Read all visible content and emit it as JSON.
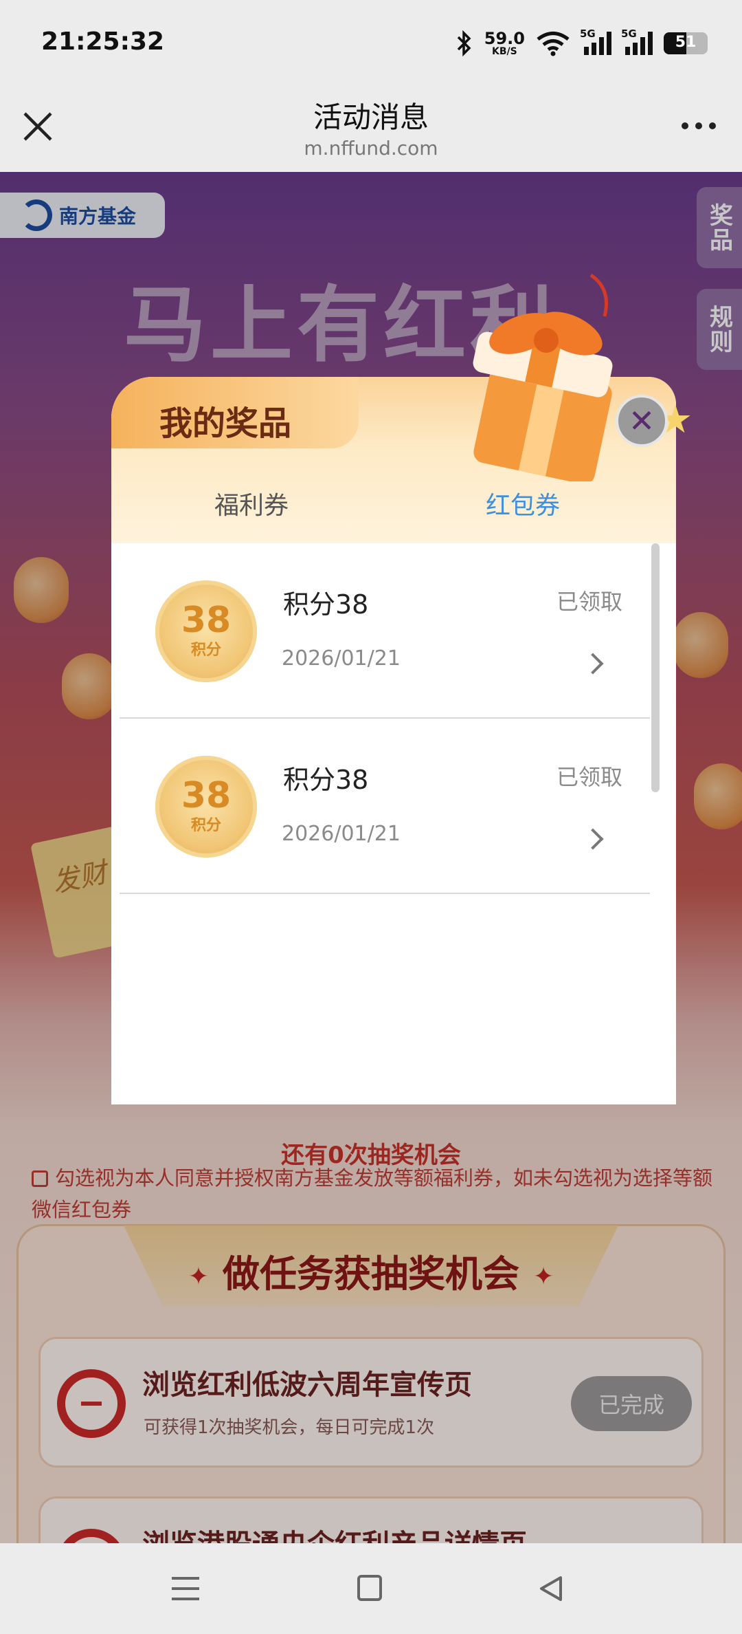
{
  "status_bar": {
    "time": "21:25:32",
    "net_speed_value": "59.0",
    "net_speed_unit": "KB/S",
    "signal1_label": "5G",
    "signal2_label": "5G",
    "battery": "51"
  },
  "titlebar": {
    "title": "活动消息",
    "url": "m.nffund.com"
  },
  "page": {
    "logo_text": "南方基金",
    "headline": "马上有红利",
    "side_tab_prizes": "奖品",
    "side_tab_rules": "规则",
    "ticket_text": "发财",
    "chance_text": "还有0次抽奖机会",
    "consent_text": "勾选视为本人同意并授权南方基金发放等额福利券，如未勾选视为选择等额微信红包券",
    "task_section_title": "做任务获抽奖机会",
    "tasks": [
      {
        "name": "浏览红利低波六周年宣传页",
        "desc": "可获得1次抽奖机会，每日可完成1次",
        "button": "已完成"
      },
      {
        "name": "浏览港股通央企红利产品详情页",
        "desc": "",
        "button": ""
      }
    ]
  },
  "modal": {
    "title": "我的奖品",
    "tabs": [
      "福利券",
      "红包券"
    ],
    "active_tab": "红包券",
    "items": [
      {
        "coin_value": "38",
        "coin_unit": "积分",
        "name": "积分38",
        "date": "2026/01/21",
        "status": "已领取"
      },
      {
        "coin_value": "38",
        "coin_unit": "积分",
        "name": "积分38",
        "date": "2026/01/21",
        "status": "已领取"
      }
    ]
  },
  "colors": {
    "active_tab": "#3d8fe0",
    "accent_red": "#c7332a",
    "modal_header": "#fbd39a"
  }
}
